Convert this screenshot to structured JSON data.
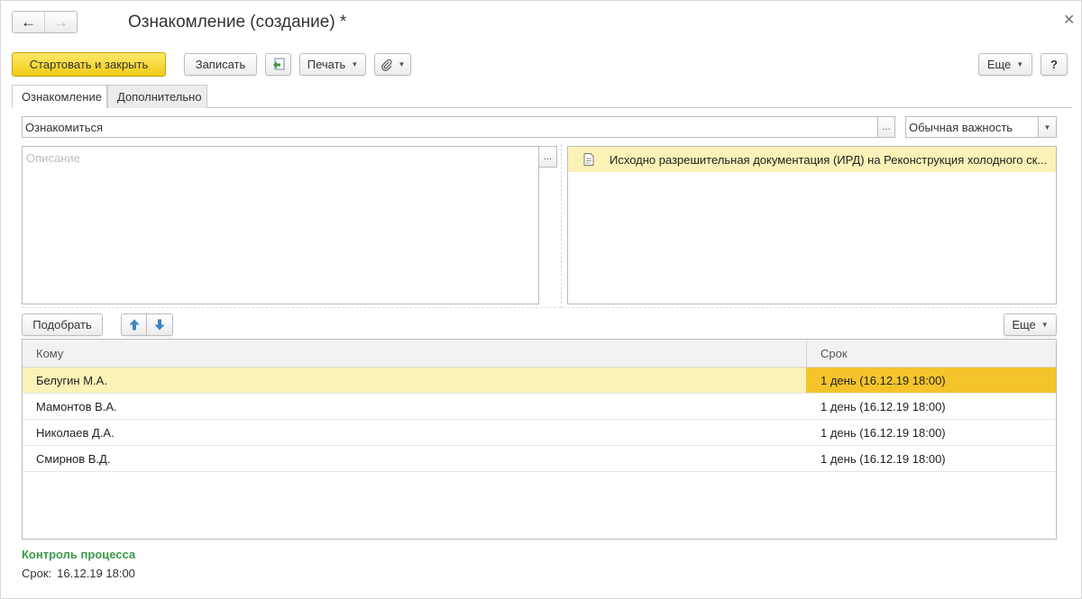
{
  "window": {
    "title": "Ознакомление (создание) *",
    "close_icon": "close-icon",
    "nav": {
      "back_icon": "arrow-left-icon",
      "forward_icon": "arrow-right-icon"
    }
  },
  "toolbar": {
    "start_close_label": "Стартовать и закрыть",
    "save_label": "Записать",
    "print_label": "Печать",
    "more_label": "Еще",
    "help_label": "?"
  },
  "tabs": [
    {
      "label": "Ознакомление",
      "active": true
    },
    {
      "label": "Дополнительно",
      "active": false
    }
  ],
  "form": {
    "subject_value": "Ознакомиться",
    "select_label": "...",
    "importance_value": "Обычная важность",
    "description_placeholder": "Описание",
    "attachment": "Исходно разрешительная документация (ИРД) на Реконструкция холодного ск..."
  },
  "participants": {
    "pick_label": "Подобрать",
    "more_label": "Еще",
    "columns": [
      "Кому",
      "Срок"
    ],
    "rows": [
      {
        "name": "Белугин М.А.",
        "term": "1 день (16.12.19 18:00)",
        "selected": true
      },
      {
        "name": "Мамонтов В.А.",
        "term": "1 день (16.12.19 18:00)",
        "selected": false
      },
      {
        "name": "Николаев Д.А.",
        "term": "1 день (16.12.19 18:00)",
        "selected": false
      },
      {
        "name": "Смирнов В.Д.",
        "term": "1 день (16.12.19 18:00)",
        "selected": false
      }
    ]
  },
  "process_control": {
    "title": "Контроль процесса",
    "term_label": "Срок:",
    "term_value": "16.12.19 18:00"
  },
  "colors": {
    "primary_button": "#f2cb15",
    "selected_row": "#fbf2b8",
    "selected_cell": "#f4c42a",
    "section_title": "#3a9a4a"
  }
}
